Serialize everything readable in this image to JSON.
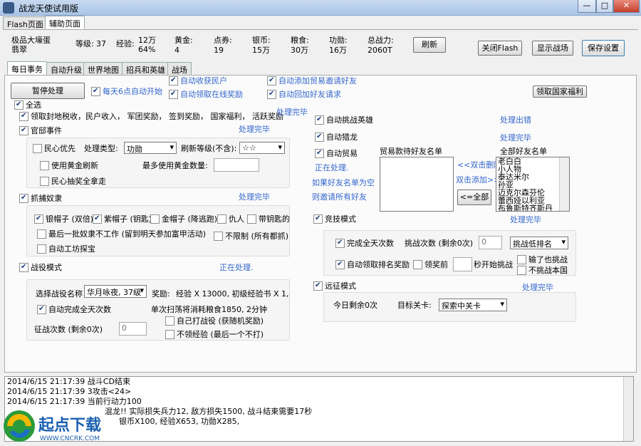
{
  "window": {
    "title": "战龙天使试用版",
    "min": "—",
    "max": "□",
    "close": "✕"
  },
  "outer_tabs": [
    "Flash页面",
    "辅助页面"
  ],
  "status": {
    "name_line1": "极品大壕蛋",
    "name_line2": "翡翠",
    "level_label": "等级:",
    "level": "37",
    "exp_label": "经验:",
    "exp_val": "12万",
    "exp_pct": "64%",
    "gold_label": "黄金:",
    "gold": "4",
    "coupon_label": "点券:",
    "coupon": "19",
    "silver_label": "银币:",
    "silver": "15万",
    "food_label": "粮食:",
    "food": "30万",
    "merit_label": "功勋:",
    "merit": "16万",
    "power_label": "总战力:",
    "power": "2060T",
    "refresh": "刷新"
  },
  "top_buttons": {
    "close_flash": "关闭Flash",
    "show_battle": "显示战场",
    "save_settings": "保存设置"
  },
  "inner_tabs": [
    "每日事务",
    "自动升级",
    "世界地图",
    "招兵和英雄",
    "战场"
  ],
  "daily": {
    "pause": "暂停处理",
    "auto6": "每天6点自动开始",
    "collect_people": "自动收获民户",
    "online_reward": "自动领取在线奖励",
    "add_trade": "自动添加贸易邀请好友",
    "reply_friend": "自动回加好友请求",
    "nation_welfare": "领取国家福利",
    "select_all": "全选",
    "collect_tax": "领取封地税收，民户收入， 军团奖励， 签到奖励， 国家福利， 活跃奖励",
    "done1": "处理完毕",
    "mansion": "官邸事件",
    "done2": "处理完毕",
    "people_first": "民心优先",
    "type_label": "处理类型:",
    "type_value": "功勋",
    "refresh_level_label": "刷新等级(不含):",
    "refresh_level_value": "☆☆",
    "use_gold_refresh": "使用黄金刷新",
    "max_gold_label": "最多使用黄金数量:",
    "people_lottery": "民心抽奖全拿走",
    "catch_slave": "抓捕奴隶",
    "done3": "处理完毕",
    "silver_hat": "银帽子 (双倍)",
    "purple_hat": "紫帽子 (钥匙)",
    "gold_hat": "金帽子 (降逃跑)",
    "enemy": "仇人",
    "key_hat": "带钥匙的",
    "last_slave": "最后一批奴隶不工作 (留到明天参加富甲活动)",
    "no_limit": "不限制 (所有都抓)",
    "workshop": "自动工坊探宝",
    "campaign": "战役模式",
    "processing1": "正在处理.",
    "campaign_select_label": "选择战役名称",
    "campaign_select_value": "华月咏夜, 37级",
    "reward_label": "奖励:",
    "reward_text": "经验 X 13000, 初级经验书 X 1,",
    "auto_complete": "自动完成全天次数",
    "sweep_cost": "单次扫荡将消耗粮食1850, 2分钟",
    "self_battle": "自己打战役 (获随机奖励)",
    "no_exp": "不领经验 (最后一个不打)",
    "campaign_times": "征战次数 (剩余0次)",
    "campaign_times_val": "0",
    "challenge_hero": "自动挑战英雄",
    "done_err": "处理出错",
    "hunt_dragon": "自动猎龙",
    "done4": "处理完毕",
    "auto_trade": "自动贸易",
    "processing2": "正在处理.",
    "add_list_empty": "如果好友名单为空",
    "invite_all": "则邀请所有好友",
    "trade_list_title": "贸易款待好友名单",
    "dbl_delete": "<<双击删除",
    "dbl_add": "双击添加>>",
    "all_btn": "<=全部",
    "all_list_title": "全部好友名单",
    "friends": [
      "老白白",
      "小人物",
      "泰达米尔",
      "孙亚",
      "迈克尔森芬伦",
      "蕾西娅以利亚",
      "布鲁斯特齐斯丹"
    ],
    "arena": "竞技模式",
    "done5": "处理完毕",
    "complete_all": "完成全天次数",
    "challenge_times": "挑战次数 (剩余0次)",
    "challenge_times_val": "0",
    "challenge_rank": "挑战低排名",
    "lose_challenge": "输了也挑战",
    "auto_rank_reward": "自动领取排名奖励",
    "before_reward": "领奖前",
    "sec_start": "秒开始挑战",
    "no_country": "不挑战本国",
    "expedition": "远征模式",
    "done6": "处理完毕",
    "today_left": "今日剩余0次",
    "target_label": "目标关卡:",
    "target_value": "探索中关卡"
  },
  "log": [
    "2014/6/15 21:17:39 战斗CD结束",
    "2014/6/15 21:17:39 3攻击<24>",
    "2014/6/15 21:17:39 当前行动力100",
    "混龙!! 实际损失兵力12, 敌方损失1500, 战斗结束需要17秒",
    "银币X100, 经验X653, 功勋X285,"
  ],
  "watermark": {
    "main": "起点下载",
    "sub": "WWW.CNCRK.COM"
  }
}
